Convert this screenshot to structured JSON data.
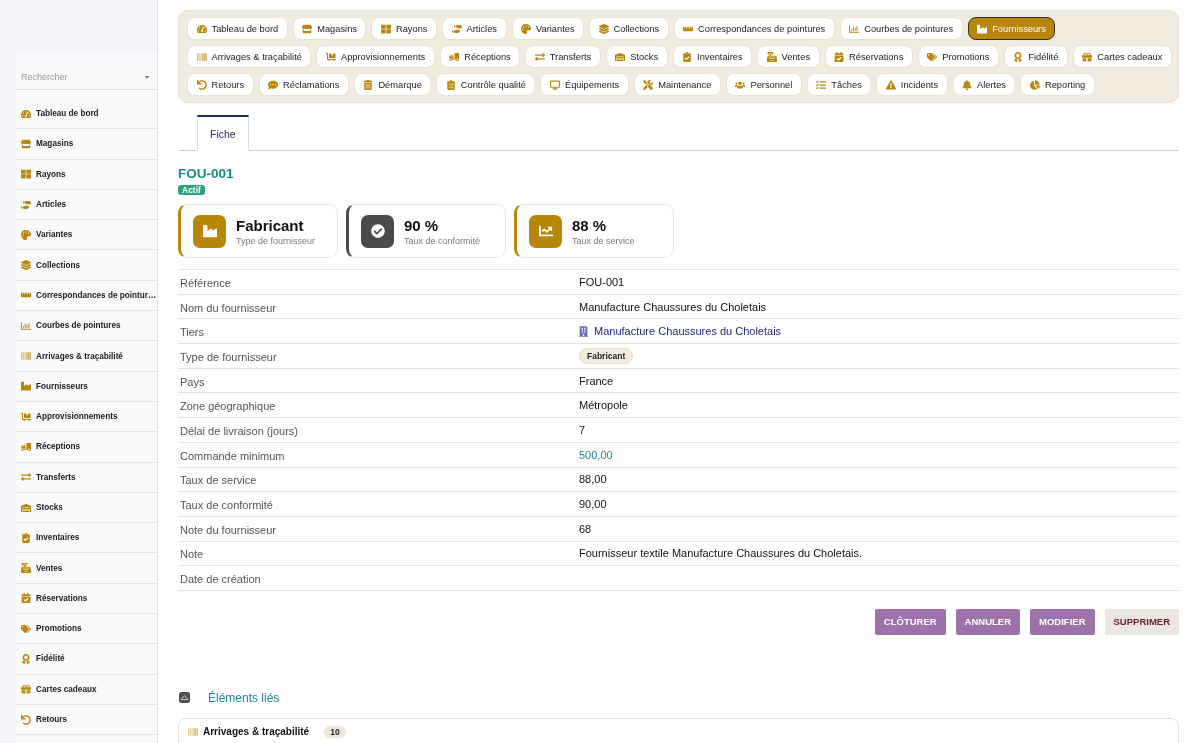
{
  "sidebar": {
    "search": {
      "placeholder": "Rechercher"
    },
    "items": [
      {
        "label": "Tableau de bord"
      },
      {
        "label": "Magasins"
      },
      {
        "label": "Rayons"
      },
      {
        "label": "Articles"
      },
      {
        "label": "Variantes"
      },
      {
        "label": "Collections"
      },
      {
        "label": "Correspondances de pointur…"
      },
      {
        "label": "Courbes de pointures"
      },
      {
        "label": "Arrivages & traçabilité"
      },
      {
        "label": "Fournisseurs"
      },
      {
        "label": "Approvisionnements"
      },
      {
        "label": "Réceptions"
      },
      {
        "label": "Transferts"
      },
      {
        "label": "Stocks"
      },
      {
        "label": "Inventaires"
      },
      {
        "label": "Ventes"
      },
      {
        "label": "Réservations"
      },
      {
        "label": "Promotions"
      },
      {
        "label": "Fidélité"
      },
      {
        "label": "Cartes cadeaux"
      },
      {
        "label": "Retours"
      }
    ]
  },
  "nav": [
    {
      "label": "Tableau de bord",
      "selected": false
    },
    {
      "label": "Magasins",
      "selected": false
    },
    {
      "label": "Rayons",
      "selected": false
    },
    {
      "label": "Articles",
      "selected": false
    },
    {
      "label": "Variantes",
      "selected": false
    },
    {
      "label": "Collections",
      "selected": false
    },
    {
      "label": "Correspondances de pointures",
      "selected": false
    },
    {
      "label": "Courbes de pointures",
      "selected": false
    },
    {
      "label": "Fournisseurs",
      "selected": true
    },
    {
      "label": "Arrivages & traçabilité",
      "selected": false
    },
    {
      "label": "Approvisionnements",
      "selected": false
    },
    {
      "label": "Réceptions",
      "selected": false
    },
    {
      "label": "Transferts",
      "selected": false
    },
    {
      "label": "Stocks",
      "selected": false
    },
    {
      "label": "Inventaires",
      "selected": false
    },
    {
      "label": "Ventes",
      "selected": false
    },
    {
      "label": "Réservations",
      "selected": false
    },
    {
      "label": "Promotions",
      "selected": false
    },
    {
      "label": "Fidélité",
      "selected": false
    },
    {
      "label": "Cartes cadeaux",
      "selected": false
    },
    {
      "label": "Retours",
      "selected": false
    },
    {
      "label": "Réclamations",
      "selected": false
    },
    {
      "label": "Démarque",
      "selected": false
    },
    {
      "label": "Contrôle qualité",
      "selected": false
    },
    {
      "label": "Équipements",
      "selected": false
    },
    {
      "label": "Maintenance",
      "selected": false
    },
    {
      "label": "Personnel",
      "selected": false
    },
    {
      "label": "Tâches",
      "selected": false
    },
    {
      "label": "Incidents",
      "selected": false
    },
    {
      "label": "Alertes",
      "selected": false
    },
    {
      "label": "Reporting",
      "selected": false
    }
  ],
  "tabs": [
    {
      "label": "Fiche",
      "selected": true
    }
  ],
  "record": {
    "title": "FOU-001",
    "status": "Actif"
  },
  "kpis": [
    {
      "value": "Fabricant",
      "label": "Type de fournisseur",
      "color": "#b8860b"
    },
    {
      "value": "90 %",
      "label": "Taux de conformité",
      "color": "#4a4a4a"
    },
    {
      "value": "88 %",
      "label": "Taux de service",
      "color": "#b8860b"
    }
  ],
  "fields": [
    {
      "label": "Référence",
      "kind": "text",
      "value": "FOU-001"
    },
    {
      "label": "Nom du fournisseur",
      "kind": "text",
      "value": "Manufacture Chaussures du Choletais"
    },
    {
      "label": "Tiers",
      "kind": "link",
      "value": "Manufacture Chaussures du Choletais"
    },
    {
      "label": "Type de fournisseur",
      "kind": "tag",
      "value": "Fabricant"
    },
    {
      "label": "Pays",
      "kind": "text",
      "value": "France"
    },
    {
      "label": "Zone géographique",
      "kind": "text",
      "value": "Métropole"
    },
    {
      "label": "Délai de livraison (jours)",
      "kind": "text",
      "value": "7"
    },
    {
      "label": "Commande minimum",
      "kind": "amount",
      "value": "500,00"
    },
    {
      "label": "Taux de service",
      "kind": "text",
      "value": "88,00"
    },
    {
      "label": "Taux de conformité",
      "kind": "text",
      "value": "90,00"
    },
    {
      "label": "Note du fournisseur",
      "kind": "text",
      "value": "68"
    },
    {
      "label": "Note",
      "kind": "text",
      "value": "Fournisseur textile Manufacture Chaussures du Choletais."
    },
    {
      "label": "Date de création"
    }
  ],
  "actions": [
    {
      "label": "CLÔTURER",
      "kind": "primary"
    },
    {
      "label": "ANNULER",
      "kind": "primary"
    },
    {
      "label": "MODIFIER",
      "kind": "primary"
    },
    {
      "label": "SUPPRIMER",
      "kind": "danger"
    }
  ],
  "related": {
    "title": "Éléments liés",
    "items": [
      {
        "label": "Arrivages & traçabilité",
        "count": "10"
      }
    ]
  }
}
